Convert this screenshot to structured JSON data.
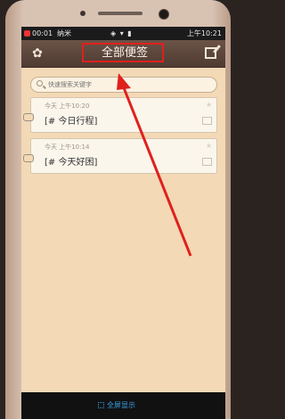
{
  "status_bar": {
    "time": "00:01",
    "center": "纳米",
    "right": "上午10:21"
  },
  "header": {
    "title": "全部便签",
    "settings_icon": "gear-icon",
    "edit_icon": "edit-icon"
  },
  "search": {
    "placeholder": "快速搜索关键字"
  },
  "notes": [
    {
      "time": "今天 上午10:20",
      "text": "[# 今日行程]"
    },
    {
      "time": "今天 上午10:14",
      "text": "[# 今天好困]"
    }
  ],
  "bottom_bar": {
    "label": "全屏显示",
    "icon": "fullscreen-icon"
  },
  "annotation": {
    "color": "#e0201c"
  }
}
